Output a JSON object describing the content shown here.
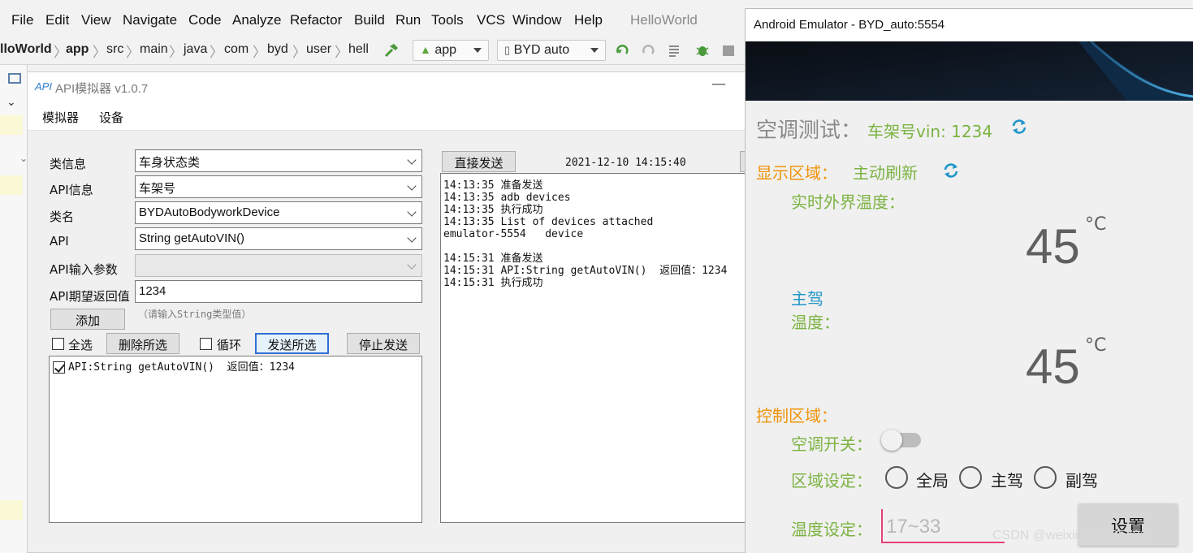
{
  "ide": {
    "menu": [
      "File",
      "Edit",
      "View",
      "Navigate",
      "Code",
      "Analyze",
      "Refactor",
      "Build",
      "Run",
      "Tools",
      "VCS",
      "Window",
      "Help"
    ],
    "project_title": "HelloWorld",
    "breadcrumbs": [
      "lloWorld",
      "app",
      "src",
      "main",
      "java",
      "com",
      "byd",
      "user",
      "hell"
    ],
    "run_config": "app",
    "device": "BYD auto"
  },
  "api": {
    "window_title": "API模拟器 v1.0.7",
    "logo": "API",
    "menu": [
      "模拟器",
      "设备"
    ],
    "labels": {
      "class_info": "类信息",
      "api_info": "API信息",
      "class_name": "类名",
      "api": "API",
      "api_params": "API输入参数",
      "expected_return": "API期望返回值"
    },
    "values": {
      "class_info": "车身状态类",
      "api_info": "车架号",
      "class_name": "BYDAutoBodyworkDevice",
      "api": "String getAutoVIN()",
      "api_params": "",
      "expected_return": "1234"
    },
    "hint": "（请输入String类型值）",
    "buttons": {
      "add": "添加",
      "select_all": "全选",
      "delete_selected": "删除所选",
      "loop": "循环",
      "send_selected": "发送所选",
      "stop_send": "停止发送",
      "direct_send": "直接发送"
    },
    "list_items": [
      {
        "checked": true,
        "text": "API:String getAutoVIN()  返回值：1234"
      }
    ],
    "timestamp": "2021-12-10 14:15:40",
    "log": "14:13:35 准备发送\n14:13:35 adb devices\n14:13:35 执行成功\n14:13:35 List of devices attached\nemulator-5554   device\n\n14:15:31 准备发送\n14:15:31 API:String getAutoVIN()  返回值：1234\n14:15:31 执行成功"
  },
  "emulator": {
    "window_title": "Android Emulator - BYD_auto:5554",
    "ac_test": "空调测试：",
    "vin_label": "车架号vin: 1234",
    "display_area": "显示区域：",
    "active_refresh": "主动刷新",
    "outside_temp_label": "实时外界温度：",
    "outside_temp": "45",
    "unit": "°C",
    "driver_label": "主驾",
    "temp_label": "温度：",
    "driver_temp": "45",
    "control_area": "控制区域：",
    "ac_switch": "空调开关：",
    "ac_on": false,
    "zone_setting": "区域设定：",
    "zones": [
      "全局",
      "主驾",
      "副驾"
    ],
    "temp_setting": "温度设定：",
    "temp_placeholder": "17~33",
    "set_button": "设置",
    "colors": {
      "green": "#7cb342",
      "orange": "#f0940a",
      "blue": "#2196c9"
    }
  },
  "watermark": "CSDN @weixin_43695721"
}
